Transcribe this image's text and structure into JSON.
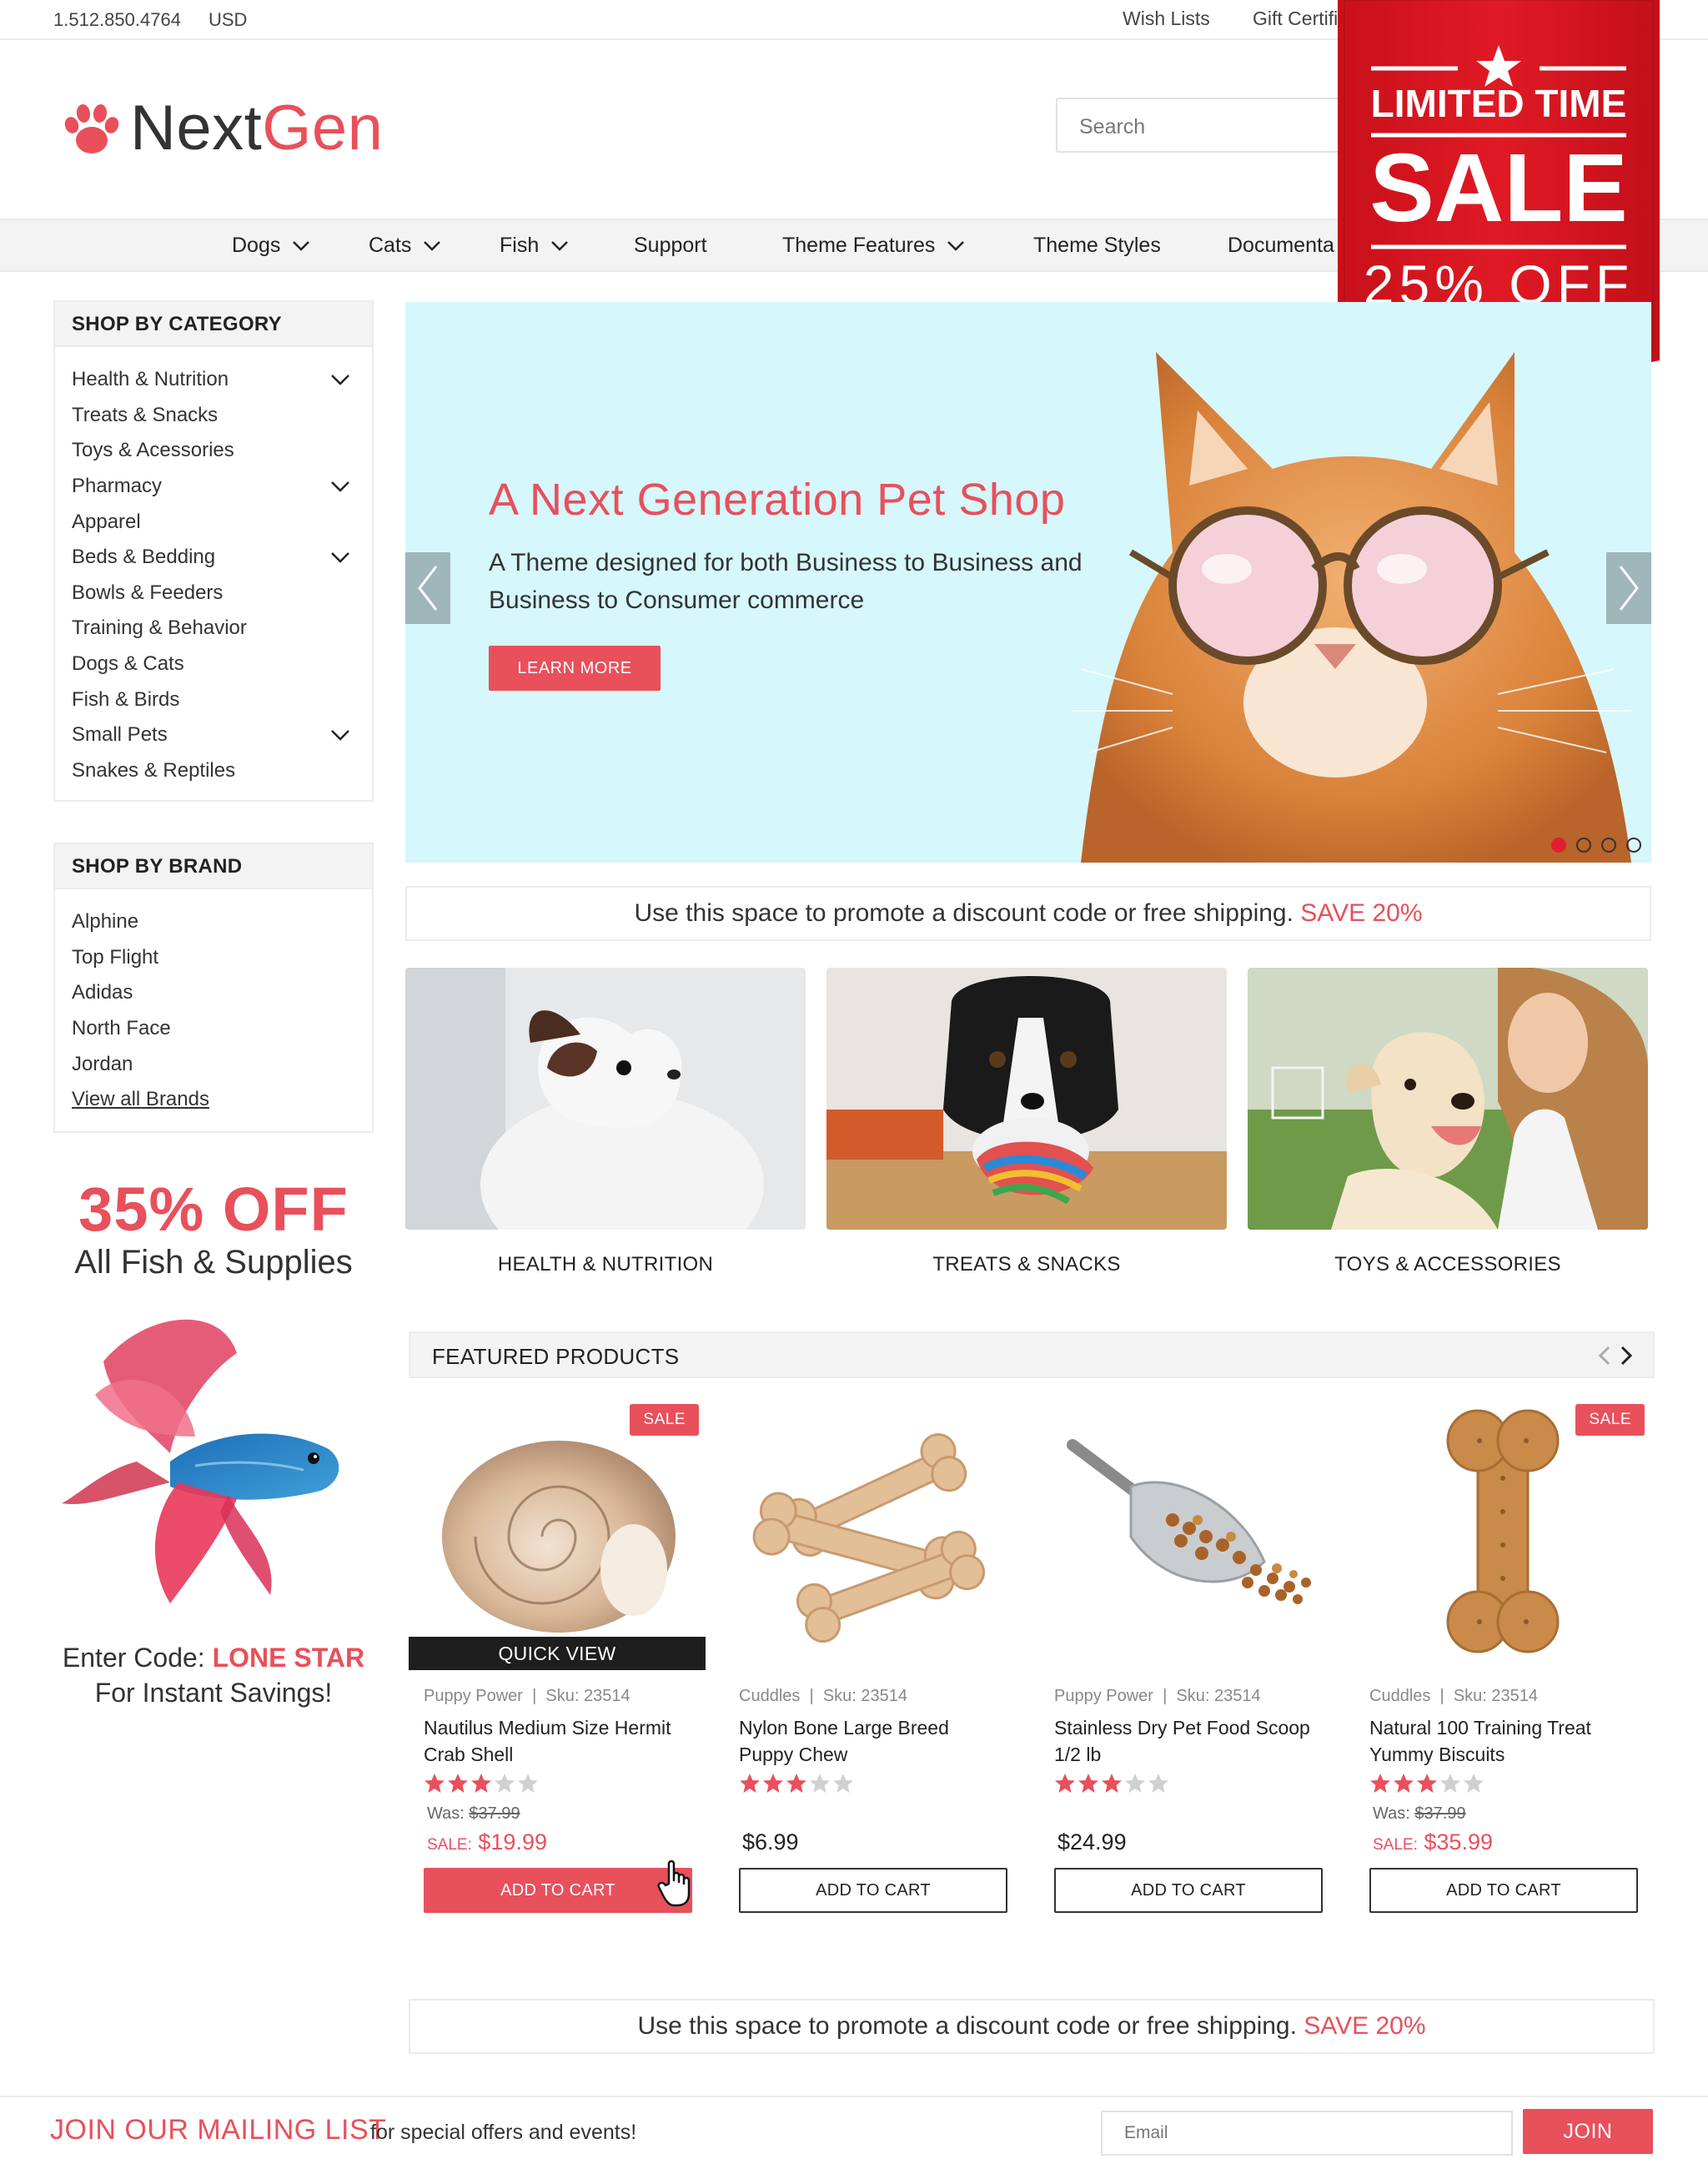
{
  "topbar": {
    "phone": "1.512.850.4764",
    "currency": "USD",
    "wish_lists": "Wish Lists",
    "gift": "Gift Certifi"
  },
  "logo": {
    "part1": "Next",
    "part2": "Gen"
  },
  "search": {
    "placeholder": "Search"
  },
  "nav": [
    {
      "label": "Dogs",
      "dropdown": true
    },
    {
      "label": "Cats",
      "dropdown": true
    },
    {
      "label": "Fish",
      "dropdown": true
    },
    {
      "label": "Support",
      "dropdown": false
    },
    {
      "label": "Theme Features",
      "dropdown": true
    },
    {
      "label": "Theme Styles",
      "dropdown": false
    },
    {
      "label": "Documenta",
      "dropdown": false
    }
  ],
  "ribbon": {
    "line1": "LIMITED TIME",
    "line2": "SALE",
    "line3": "25% OFF",
    "color": "#d9141f"
  },
  "categories": {
    "title": "SHOP BY CATEGORY",
    "items": [
      {
        "label": "Health & Nutrition",
        "expandable": true
      },
      {
        "label": "Treats & Snacks",
        "expandable": false
      },
      {
        "label": "Toys & Acessories",
        "expandable": false
      },
      {
        "label": "Pharmacy",
        "expandable": true
      },
      {
        "label": "Apparel",
        "expandable": false
      },
      {
        "label": "Beds & Bedding",
        "expandable": true
      },
      {
        "label": "Bowls & Feeders",
        "expandable": false
      },
      {
        "label": "Training & Behavior",
        "expandable": false
      },
      {
        "label": "Dogs & Cats",
        "expandable": false
      },
      {
        "label": "Fish & Birds",
        "expandable": false
      },
      {
        "label": "Small Pets",
        "expandable": true
      },
      {
        "label": "Snakes & Reptiles",
        "expandable": false
      }
    ]
  },
  "brands": {
    "title": "SHOP BY BRAND",
    "items": [
      "Alphine",
      "Top Flight",
      "Adidas",
      "North Face",
      "Jordan"
    ],
    "view_all": "View all Brands"
  },
  "fish_promo": {
    "discount": "35% OFF",
    "subtitle": "All Fish & Supplies",
    "code_prefix": "Enter Code: ",
    "code": "LONE STAR",
    "footer": "For Instant Savings!"
  },
  "hero": {
    "title": "A Next Generation Pet Shop",
    "description": "A Theme designed for both Business to Business and Business to Consumer commerce",
    "button": "LEARN MORE",
    "slides": 4,
    "active_slide": 1,
    "bg": "#d6f7fb"
  },
  "promo": {
    "text": "Use this space to promote a discount code or free shipping.",
    "highlight": "SAVE 20%"
  },
  "tiles": [
    {
      "label": "HEALTH & NUTRITION"
    },
    {
      "label": "TREATS & SNACKS"
    },
    {
      "label": "TOYS & ACCESSORIES"
    }
  ],
  "featured": {
    "title": "FEATURED PRODUCTS",
    "products": [
      {
        "brand": "Puppy Power",
        "sku": "Sku: 23514",
        "name": "Nautilus Medium Size Hermit Crab Shell",
        "rating": 3,
        "on_sale": true,
        "sale_tag": "SALE",
        "was_label": "Was:",
        "was": "$37.99",
        "sale_label": "SALE:",
        "price": "$19.99",
        "button": "ADD TO CART",
        "quick_view": "QUICK VIEW",
        "image": "shell-image"
      },
      {
        "brand": "Cuddles",
        "sku": "Sku: 23514",
        "name": "Nylon Bone Large Breed Puppy Chew",
        "rating": 3,
        "on_sale": false,
        "price": "$6.99",
        "button": "ADD TO CART",
        "image": "rawhide-bones-image"
      },
      {
        "brand": "Puppy Power",
        "sku": "Sku: 23514",
        "name": "Stainless Dry Pet Food Scoop 1/2 lb",
        "rating": 3,
        "on_sale": false,
        "price": "$24.99",
        "button": "ADD TO CART",
        "image": "food-scoop-image"
      },
      {
        "brand": "Cuddles",
        "sku": "Sku: 23514",
        "name": "Natural 100 Training Treat Yummy Biscuits",
        "rating": 3,
        "on_sale": true,
        "sale_tag": "SALE",
        "was_label": "Was:",
        "was": "$37.99",
        "sale_label": "SALE:",
        "price": "$35.99",
        "button": "ADD TO CART",
        "image": "bone-biscuit-image"
      }
    ]
  },
  "mailing": {
    "title": "JOIN OUR MAILING LIST",
    "subtitle": "for special offers and events!",
    "placeholder": "Email",
    "button": "JOIN"
  },
  "colors": {
    "accent": "#e8505b",
    "nav_bg": "#f3f3f3",
    "star_filled": "#e8505b",
    "star_empty": "#d0d0d0"
  }
}
